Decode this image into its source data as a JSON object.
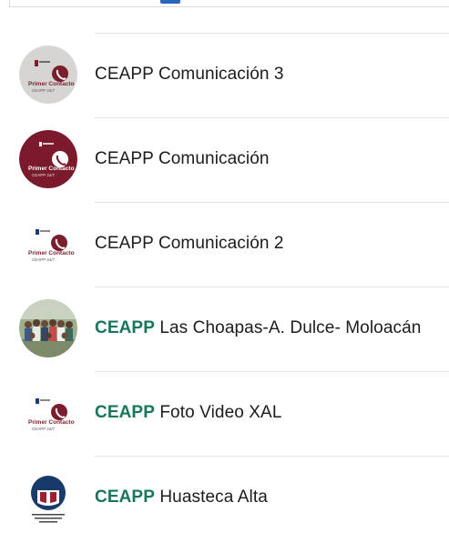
{
  "accent_color": "#17775a",
  "contacts": [
    {
      "highlight": "",
      "name": "CEAPP Comunicación 3",
      "avatar_icon": "primer-contacto-logo-grey",
      "avatar_text": [
        "Primer Contacto",
        "CEAPP 24/7"
      ]
    },
    {
      "highlight": "",
      "name": "CEAPP Comunicación",
      "avatar_icon": "primer-contacto-logo-maroon",
      "avatar_text": [
        "Primer Contacto",
        "CEAPP 24/7"
      ]
    },
    {
      "highlight": "",
      "name": "CEAPP Comunicación 2",
      "avatar_icon": "primer-contacto-logo-white",
      "avatar_text": [
        "Primer Contacto",
        "CEAPP 24/7"
      ]
    },
    {
      "highlight": "CEAPP",
      "name": " Las Choapas-A. Dulce- Moloacán",
      "avatar_icon": "group-photo",
      "avatar_text": []
    },
    {
      "highlight": "CEAPP",
      "name": " Foto Video XAL",
      "avatar_icon": "primer-contacto-logo-white",
      "avatar_text": [
        "Primer Contacto",
        "CEAPP 24/7"
      ]
    },
    {
      "highlight": "CEAPP",
      "name": " Huasteca Alta",
      "avatar_icon": "ceapp-commission-logo",
      "avatar_text": []
    }
  ]
}
